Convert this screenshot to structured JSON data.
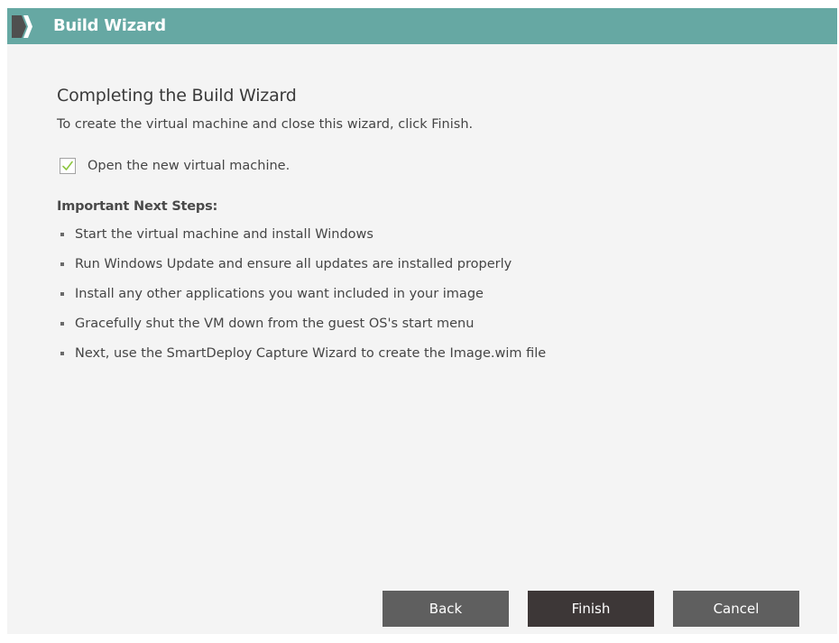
{
  "window": {
    "title": "Build Wizard"
  },
  "page": {
    "heading": "Completing the Build Wizard",
    "subheading": "To create the virtual machine and close this wizard, click Finish."
  },
  "open_vm_checkbox": {
    "label": "Open the new virtual machine.",
    "checked": true
  },
  "next_steps": {
    "heading": "Important Next Steps:",
    "items": [
      "Start the virtual machine and install Windows",
      "Run Windows Update and ensure all updates are installed properly",
      "Install any other applications you want included in your image",
      "Gracefully shut the VM down from the guest OS's start menu",
      "Next, use the SmartDeploy Capture Wizard to create the Image.wim file"
    ]
  },
  "buttons": {
    "back": "Back",
    "finish": "Finish",
    "cancel": "Cancel"
  },
  "colors": {
    "titlebar": "#66a8a3",
    "checkmark": "#8cc63f",
    "button": "#5f5f5f",
    "primary_button": "#3d3737"
  },
  "icons": {
    "title": "chevron-right-icon",
    "checkbox": "checkmark-icon"
  }
}
